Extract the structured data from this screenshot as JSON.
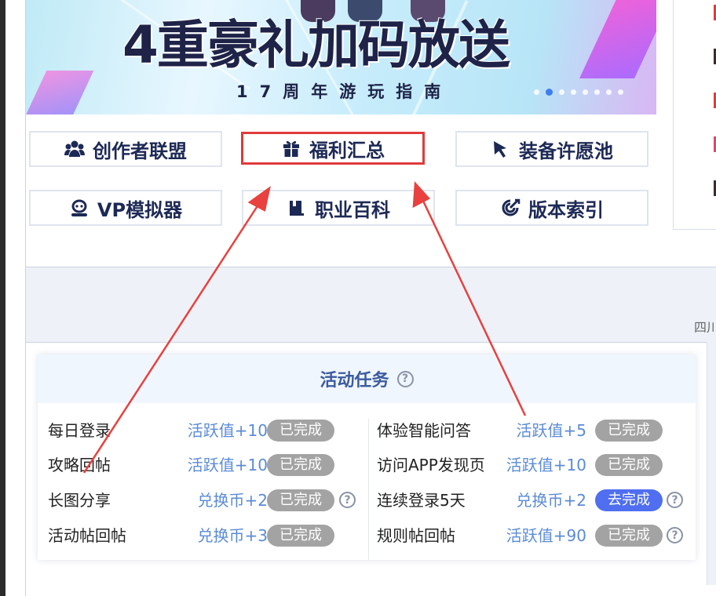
{
  "banner": {
    "title": "4重豪礼加码放送",
    "subtitle": "17周年游玩指南",
    "carousel_total": 8,
    "carousel_active": 2
  },
  "nav": {
    "buttons": [
      {
        "label": "创作者联盟",
        "icon": "users-icon",
        "highlighted": false
      },
      {
        "label": "福利汇总",
        "icon": "gift-icon",
        "highlighted": true
      },
      {
        "label": "装备许愿池",
        "icon": "cursor-icon",
        "highlighted": false
      },
      {
        "label": "VP模拟器",
        "icon": "robot-icon",
        "highlighted": false
      },
      {
        "label": "职业百科",
        "icon": "book-icon",
        "highlighted": false
      },
      {
        "label": "版本索引",
        "icon": "target-icon",
        "highlighted": false
      }
    ]
  },
  "band": {
    "partial_text": "四川"
  },
  "tasks": {
    "title": "活动任务",
    "help_icon": "question-icon",
    "left": [
      {
        "name": "每日登录",
        "reward": "活跃值+10",
        "status": "已完成",
        "help": false
      },
      {
        "name": "攻略回帖",
        "reward": "活跃值+10",
        "status": "已完成",
        "help": false
      },
      {
        "name": "长图分享",
        "reward": "兑换币+2",
        "status": "已完成",
        "help": true
      },
      {
        "name": "活动帖回帖",
        "reward": "兑换币+3",
        "status": "已完成",
        "help": false
      }
    ],
    "right": [
      {
        "name": "体验智能问答",
        "reward": "活跃值+5",
        "status": "已完成",
        "help": false
      },
      {
        "name": "访问APP发现页",
        "reward": "活跃值+10",
        "status": "已完成",
        "help": false
      },
      {
        "name": "连续登录5天",
        "reward": "兑换币+2",
        "status": "去完成",
        "help": true
      },
      {
        "name": "规则帖回帖",
        "reward": "活跃值+90",
        "status": "已完成",
        "help": true
      }
    ]
  },
  "colors": {
    "nav_text": "#1d2955",
    "highlight_border": "#e03a3a",
    "annotation_arrow": "#e8413f",
    "reward_text": "#5b8bd6",
    "status_done": "#a3a3a3",
    "status_todo": "#4f6ef0"
  }
}
